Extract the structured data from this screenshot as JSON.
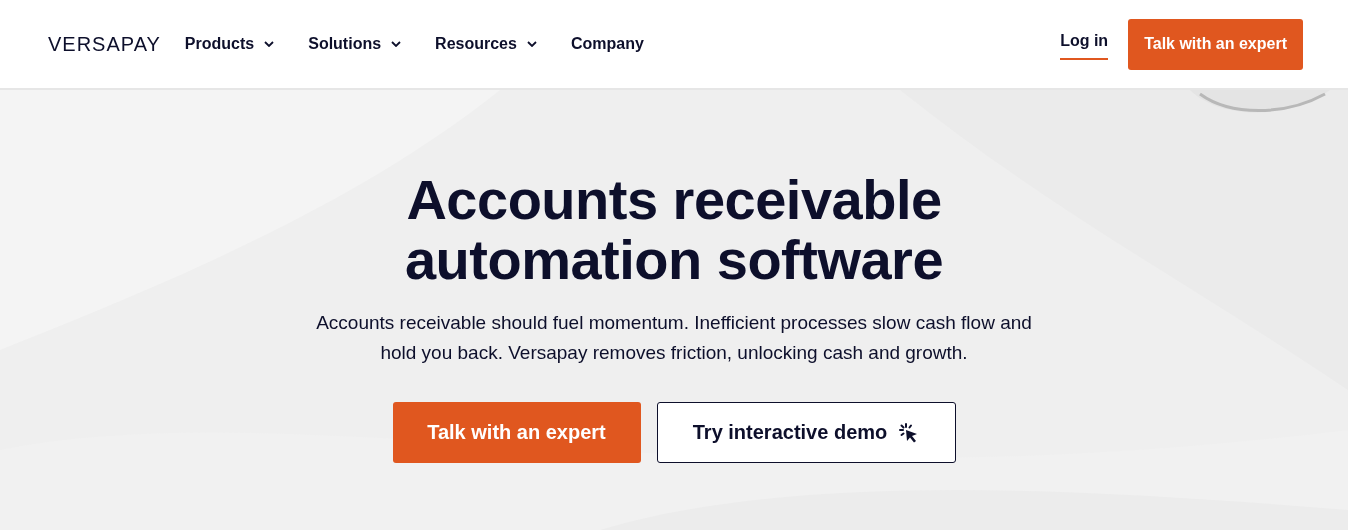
{
  "header": {
    "logo": "VERSAPAY",
    "nav": [
      {
        "label": "Products",
        "has_menu": true
      },
      {
        "label": "Solutions",
        "has_menu": true
      },
      {
        "label": "Resources",
        "has_menu": true
      },
      {
        "label": "Company",
        "has_menu": false
      }
    ],
    "login": "Log in",
    "cta": "Talk with an expert"
  },
  "hero": {
    "title": "Accounts receivable automation software",
    "text": "Accounts receivable should fuel momentum. Inefficient processes slow cash flow and hold you back. Versapay removes friction, unlocking cash and growth.",
    "primary": "Talk with an expert",
    "secondary": "Try interactive demo"
  }
}
